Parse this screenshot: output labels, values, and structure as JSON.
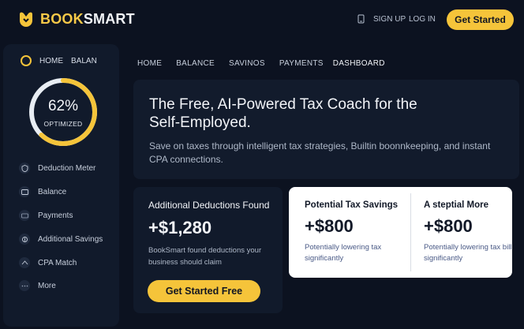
{
  "header": {
    "logo": {
      "brand_a": "BOOK",
      "brand_b": "SMART",
      "icon": "book-smart-logo-icon"
    },
    "signup": "SIGN UP",
    "login": "LOG IN",
    "cta": "Get Started",
    "icon": "phone-icon"
  },
  "sidebar": {
    "top_home": "HOME",
    "top_balan": "BALAN",
    "gauge": {
      "value": "62%",
      "label": "OPTIMIZED",
      "fraction": 0.62
    },
    "items": [
      {
        "label": "Deduction Meter",
        "icon": "shield-icon"
      },
      {
        "label": "Balance",
        "icon": "card-icon"
      },
      {
        "label": "Payments",
        "icon": "payments-icon"
      },
      {
        "label": "Additional Savings",
        "icon": "savings-icon"
      },
      {
        "label": "CPA Match",
        "icon": "cpa-icon"
      },
      {
        "label": "More",
        "icon": "more-icon"
      }
    ]
  },
  "main_nav": {
    "tabs": [
      "HOME",
      "BALANCE",
      "SAVINOS",
      "PAYMENTS",
      "DASHBOARD"
    ],
    "active": "DASHBOARD"
  },
  "hero": {
    "title": "The Free, AI-Powered Tax Coach for the Self-Employed.",
    "subtitle": "Save on taxes through intelligent tax strategies, Builtin boonnkeeping, and instant CPA connections."
  },
  "card_left": {
    "title": "Additional Deductions Found",
    "value": "+$1,280",
    "desc": "BookSmart found deductions your business should claim",
    "button": "Get Started Free"
  },
  "card_white": {
    "col1": {
      "title": "Potential Tax Savings",
      "value": "+$800",
      "desc": "Potentially lowering tax significantly"
    },
    "col2": {
      "title": "A steptial More",
      "value": "+$800",
      "desc": "Potentially lowering tax bill significantly"
    }
  },
  "colors": {
    "accent": "#f5c43a",
    "bg": "#0c1220",
    "panel": "#111a2b",
    "white_card": "#ffffff"
  }
}
